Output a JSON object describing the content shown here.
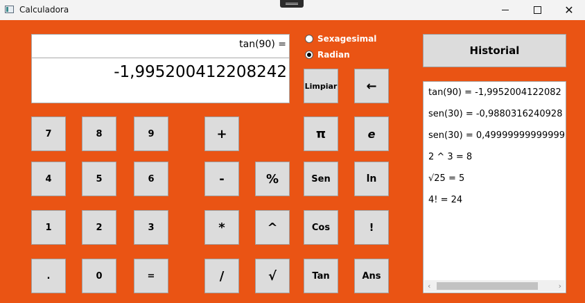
{
  "window": {
    "title": "Calculadora",
    "icon": "calculator-app-icon"
  },
  "display": {
    "expression": "tan(90) =",
    "result": "-1,995200412208242"
  },
  "mode": {
    "options": [
      "Sexagesimal",
      "Radian"
    ],
    "selected": "Radian"
  },
  "buttons": {
    "clear": "Limpiar",
    "backspace": "←",
    "pi": "π",
    "e": "e",
    "sen": "Sen",
    "ln": "ln",
    "cos": "Cos",
    "factorial": "!",
    "tan": "Tan",
    "ans": "Ans",
    "d7": "7",
    "d8": "8",
    "d9": "9",
    "d4": "4",
    "d5": "5",
    "d6": "6",
    "d1": "1",
    "d2": "2",
    "d3": "3",
    "dot": ".",
    "d0": "0",
    "equals": "=",
    "plus": "+",
    "minus": "-",
    "percent": "%",
    "multiply": "*",
    "power": "^",
    "divide": "/",
    "sqrt": "√"
  },
  "history": {
    "button_label": "Historial",
    "items": [
      "tan(90) = -1,9952004122082",
      "sen(30) = -0,9880316240928",
      "sen(30) = 0,49999999999999",
      "2 ^ 3 = 8",
      "√25 = 5",
      "4! = 24"
    ]
  },
  "colors": {
    "background": "#ea5414",
    "button": "#dcdcdc",
    "titlebar": "#f3f3f3"
  }
}
